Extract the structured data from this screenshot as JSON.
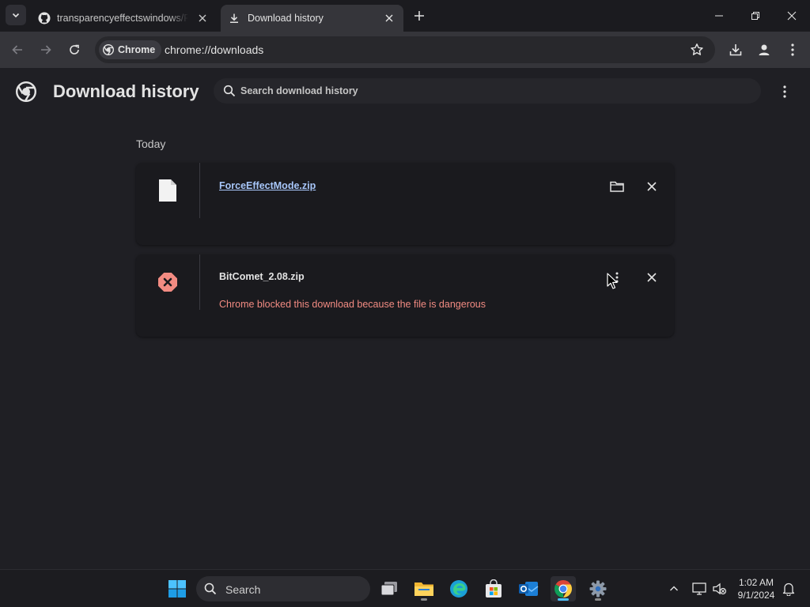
{
  "browser": {
    "tabs": [
      {
        "title": "transparencyeffectswindows/Fo",
        "active": false,
        "icon": "github-icon"
      },
      {
        "title": "Download history",
        "active": true,
        "icon": "download-icon"
      }
    ],
    "address_chip": "Chrome",
    "url": "chrome://downloads"
  },
  "page": {
    "title": "Download history",
    "search_placeholder": "Search download history",
    "sections": [
      {
        "date": "Today",
        "items": [
          {
            "filename": "ForceEffectMode.zip",
            "status": "complete",
            "message": ""
          },
          {
            "filename": "BitComet_2.08.zip",
            "status": "blocked",
            "message": "Chrome blocked this download because the file is dangerous"
          }
        ]
      }
    ]
  },
  "taskbar": {
    "search_label": "Search",
    "time": "1:02 AM",
    "date": "9/1/2024"
  },
  "colors": {
    "accent_link": "#a8c7fa",
    "danger": "#f28b82",
    "page_background": "#1f1f24"
  }
}
